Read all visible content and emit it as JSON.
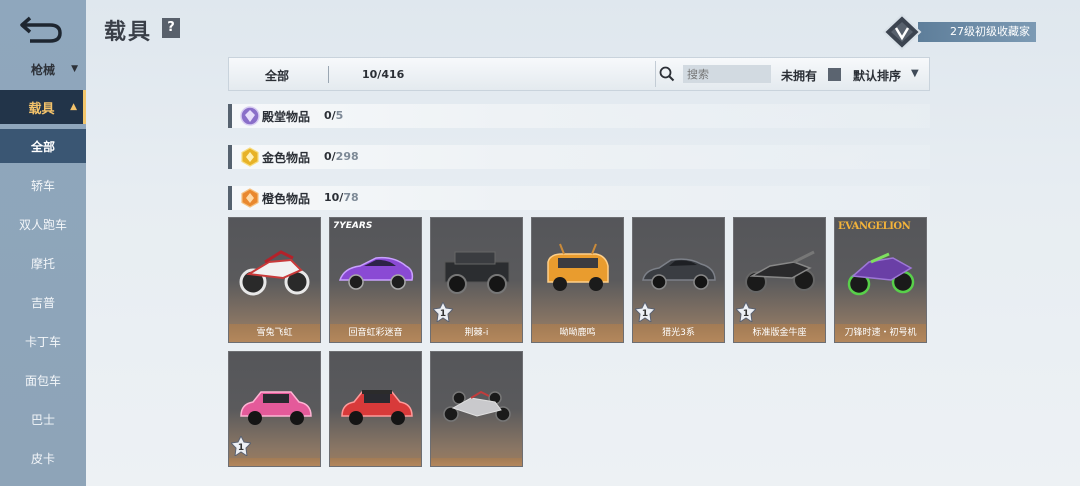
{
  "sidebar": {
    "weapon": "枪械",
    "vehicle": "载具",
    "items": [
      "全部",
      "轿车",
      "双人跑车",
      "摩托",
      "吉普",
      "卡丁车",
      "面包车",
      "巴士",
      "皮卡"
    ]
  },
  "header": {
    "title": "载具",
    "help_icon": "?",
    "rank": "27级初级收藏家"
  },
  "filter": {
    "tab_all": "全部",
    "count": "10/416",
    "search_placeholder": "搜索",
    "unowned_label": "未拥有",
    "sort_label": "默认排序"
  },
  "categories": [
    {
      "label": "殿堂物品",
      "owned": "0/",
      "total": "5",
      "color": "#8a6fc9"
    },
    {
      "label": "金色物品",
      "owned": "0/",
      "total": "298",
      "color": "#e7b227"
    },
    {
      "label": "橙色物品",
      "owned": "10/",
      "total": "78",
      "color": "#e9882f"
    }
  ],
  "cards": [
    {
      "label": "雪兔飞虹",
      "badge": "",
      "icon": "motorcycle-icon"
    },
    {
      "label": "回音虹彩迷音",
      "badge": "",
      "icon": "sports-car-icon"
    },
    {
      "label": "荆棘-i",
      "badge": "1",
      "icon": "jeep-icon"
    },
    {
      "label": "呦呦鹿鸣",
      "badge": "",
      "icon": "van-icon"
    },
    {
      "label": "猎光3系",
      "badge": "1",
      "icon": "sedan-icon"
    },
    {
      "label": "标准版金牛座",
      "badge": "1",
      "icon": "motorcycle-icon"
    },
    {
      "label": "刀锋时速・初号机",
      "badge": "",
      "icon": "motorcycle-icon"
    },
    {
      "label": "",
      "badge": "1",
      "icon": "mini-car-icon"
    },
    {
      "label": "",
      "badge": "",
      "icon": "mini-car-icon"
    },
    {
      "label": "",
      "badge": "",
      "icon": "kart-icon"
    }
  ],
  "brand_logo": "7YEARS",
  "eva_logo": "EVANGELION"
}
